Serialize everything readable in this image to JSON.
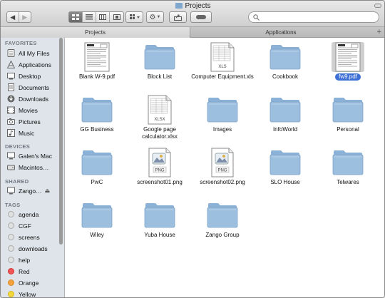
{
  "window": {
    "title": "Projects"
  },
  "toolbar": {
    "back_label": "◀",
    "forward_label": "▶",
    "view_icons": [
      "icon-view",
      "list-view",
      "column-view",
      "coverflow-view"
    ],
    "search_placeholder": ""
  },
  "tabs": [
    {
      "label": "Projects",
      "active": true
    },
    {
      "label": "Applications",
      "active": false
    }
  ],
  "sidebar": {
    "favorites_header": "FAVORITES",
    "favorites": [
      {
        "label": "All My Files",
        "icon": "all-files-icon"
      },
      {
        "label": "Applications",
        "icon": "applications-icon"
      },
      {
        "label": "Desktop",
        "icon": "desktop-icon"
      },
      {
        "label": "Documents",
        "icon": "documents-icon"
      },
      {
        "label": "Downloads",
        "icon": "downloads-icon"
      },
      {
        "label": "Movies",
        "icon": "movies-icon"
      },
      {
        "label": "Pictures",
        "icon": "pictures-icon"
      },
      {
        "label": "Music",
        "icon": "music-icon"
      }
    ],
    "devices_header": "DEVICES",
    "devices": [
      {
        "label": "Galen's Mac",
        "icon": "computer-icon"
      },
      {
        "label": "Macintos…",
        "icon": "hard-drive-icon"
      }
    ],
    "shared_header": "SHARED",
    "shared": [
      {
        "label": "Zango…",
        "icon": "server-icon"
      }
    ],
    "tags_header": "TAGS",
    "tags": [
      {
        "label": "agenda",
        "color": "#e0e0e0"
      },
      {
        "label": "CGF",
        "color": "#e0e0e0"
      },
      {
        "label": "screens",
        "color": "#e0e0e0"
      },
      {
        "label": "downloads",
        "color": "#e0e0e0"
      },
      {
        "label": "help",
        "color": "#e0e0e0"
      },
      {
        "label": "Red",
        "color": "#f05454"
      },
      {
        "label": "Orange",
        "color": "#f5a23c"
      },
      {
        "label": "Yellow",
        "color": "#f3d73a"
      }
    ]
  },
  "files": [
    {
      "label": "Blank W-9.pdf",
      "kind": "document",
      "selected": false
    },
    {
      "label": "Block List",
      "kind": "folder",
      "selected": false
    },
    {
      "label": "Computer Equipment.xls",
      "kind": "spreadsheet",
      "badge": "XLS",
      "selected": false
    },
    {
      "label": "Cookbook",
      "kind": "folder",
      "selected": false
    },
    {
      "label": "fw9.pdf",
      "kind": "document",
      "selected": true
    },
    {
      "label": "GG Business",
      "kind": "folder",
      "selected": false
    },
    {
      "label": "Google page calculator.xlsx",
      "kind": "spreadsheet",
      "badge": "XLSX",
      "selected": false
    },
    {
      "label": "Images",
      "kind": "folder",
      "selected": false
    },
    {
      "label": "InfoWorld",
      "kind": "folder",
      "selected": false
    },
    {
      "label": "Personal",
      "kind": "folder",
      "selected": false
    },
    {
      "label": "PwC",
      "kind": "folder",
      "selected": false
    },
    {
      "label": "screenshot01.png",
      "kind": "image",
      "badge": "PNG",
      "selected": false
    },
    {
      "label": "screenshot02.png",
      "kind": "image",
      "badge": "PNG",
      "selected": false
    },
    {
      "label": "SLO House",
      "kind": "folder",
      "selected": false
    },
    {
      "label": "Telwares",
      "kind": "folder",
      "selected": false
    },
    {
      "label": "Wiley",
      "kind": "folder",
      "selected": false
    },
    {
      "label": "Yuba House",
      "kind": "folder",
      "selected": false
    },
    {
      "label": "Zango Group",
      "kind": "folder",
      "selected": false
    }
  ],
  "colors": {
    "folder_body": "#9dbfdf",
    "folder_tab": "#8cb1d6",
    "selection": "#3d6fd5",
    "sidebar_bg": "#dfe4ea"
  }
}
